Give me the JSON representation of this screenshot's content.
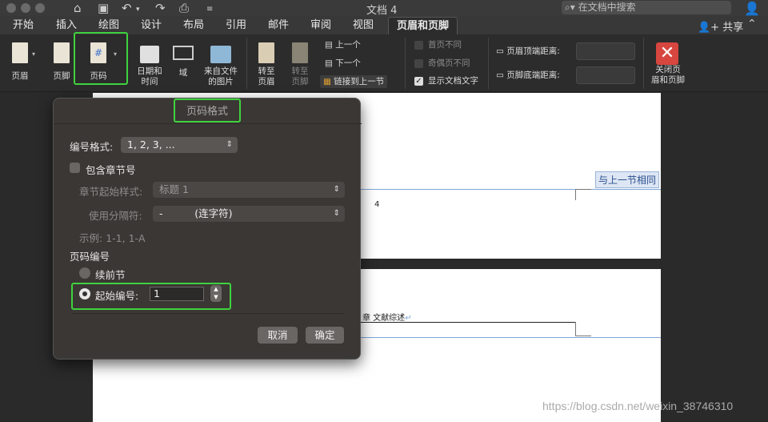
{
  "window": {
    "title": "文档 4",
    "search_placeholder": "在文档中搜索"
  },
  "tabs": [
    {
      "label": "开始"
    },
    {
      "label": "插入"
    },
    {
      "label": "绘图"
    },
    {
      "label": "设计"
    },
    {
      "label": "布局"
    },
    {
      "label": "引用"
    },
    {
      "label": "邮件"
    },
    {
      "label": "审阅"
    },
    {
      "label": "视图"
    },
    {
      "label": "页眉和页脚",
      "active": true
    }
  ],
  "share_label": "共享",
  "ribbon": {
    "header": "页眉",
    "footer": "页脚",
    "page_number": "页码",
    "date_time": "日期和\n时间",
    "field": "域",
    "picture_from_file": "来自文件\n的图片",
    "goto_header": "转至\n页眉",
    "goto_footer": "转至\n页脚",
    "previous": "上一个",
    "next": "下一个",
    "link_previous": "链接到上一节",
    "different_first": "首页不同",
    "different_odd_even": "奇偶页不同",
    "show_document_text": "显示文档文字",
    "header_top_distance": "页眉顶端距离:",
    "footer_bottom_distance": "页脚底端距离:",
    "close_header_footer": "关闭页\n眉和页脚"
  },
  "document": {
    "same_as_previous": "与上一节相同",
    "page_num_text": "4",
    "chapter_text": "章  文献综述",
    "para_mark": "↵"
  },
  "dialog": {
    "title": "页码格式",
    "number_format_label": "编号格式:",
    "number_format_value": "1, 2, 3, ...",
    "include_chapter_label": "包含章节号",
    "chapter_start_style_label": "章节起始样式:",
    "chapter_start_style_value": "标题 1",
    "separator_label": "使用分隔符:",
    "separator_value": "-          (连字符)",
    "example_label": "示例:",
    "example_value": "1-1, 1-A",
    "page_numbering_label": "页码编号",
    "continue_label": "续前节",
    "start_at_label": "起始编号:",
    "start_at_value": "1",
    "cancel": "取消",
    "ok": "确定"
  },
  "watermark": "https://blog.csdn.net/weixin_38746310"
}
